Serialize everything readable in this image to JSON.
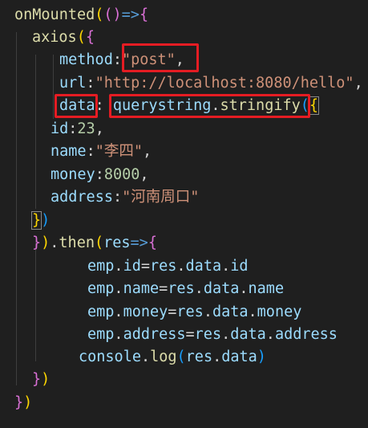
{
  "editor": {
    "lines": [
      {
        "tokens": [
          "onMounted",
          "(",
          "(",
          ")",
          "=>",
          "{"
        ]
      },
      {
        "tokens": [
          "axios",
          "(",
          "{"
        ]
      },
      {
        "tokens": [
          "method",
          ":",
          "\"post\"",
          ","
        ]
      },
      {
        "tokens": [
          "url",
          ":",
          "\"http://localhost:8080/hello\"",
          ","
        ]
      },
      {
        "tokens": [
          "data",
          ":",
          " querystring",
          ".",
          "stringify",
          "(",
          "{"
        ]
      },
      {
        "tokens": [
          "id",
          ":",
          "23",
          ","
        ]
      },
      {
        "tokens": [
          "name",
          ":",
          "\"李四\"",
          ","
        ]
      },
      {
        "tokens": [
          "money",
          ":",
          "8000",
          ","
        ]
      },
      {
        "tokens": [
          "address",
          ":",
          "\"河南周口\""
        ]
      },
      {
        "tokens": [
          "}",
          ")"
        ]
      },
      {
        "tokens": [
          "}",
          ")",
          ".",
          "then",
          "(",
          "res",
          "=>",
          "{"
        ]
      },
      {
        "tokens": [
          "emp",
          ".",
          "id",
          "=",
          "res",
          ".",
          "data",
          ".",
          "id"
        ]
      },
      {
        "tokens": [
          "emp",
          ".",
          "name",
          "=",
          "res",
          ".",
          "data",
          ".",
          "name"
        ]
      },
      {
        "tokens": [
          "emp",
          ".",
          "money",
          "=",
          "res",
          ".",
          "data",
          ".",
          "money"
        ]
      },
      {
        "tokens": [
          "emp",
          ".",
          "address",
          "=",
          "res",
          ".",
          "data",
          ".",
          "address"
        ]
      },
      {
        "tokens": [
          "console",
          ".",
          "log",
          "(",
          "res",
          ".",
          "data",
          ")"
        ]
      },
      {
        "tokens": [
          "}",
          ")"
        ]
      },
      {
        "tokens": [
          "}",
          ")"
        ]
      }
    ]
  },
  "highlight_color": "#e51c23"
}
